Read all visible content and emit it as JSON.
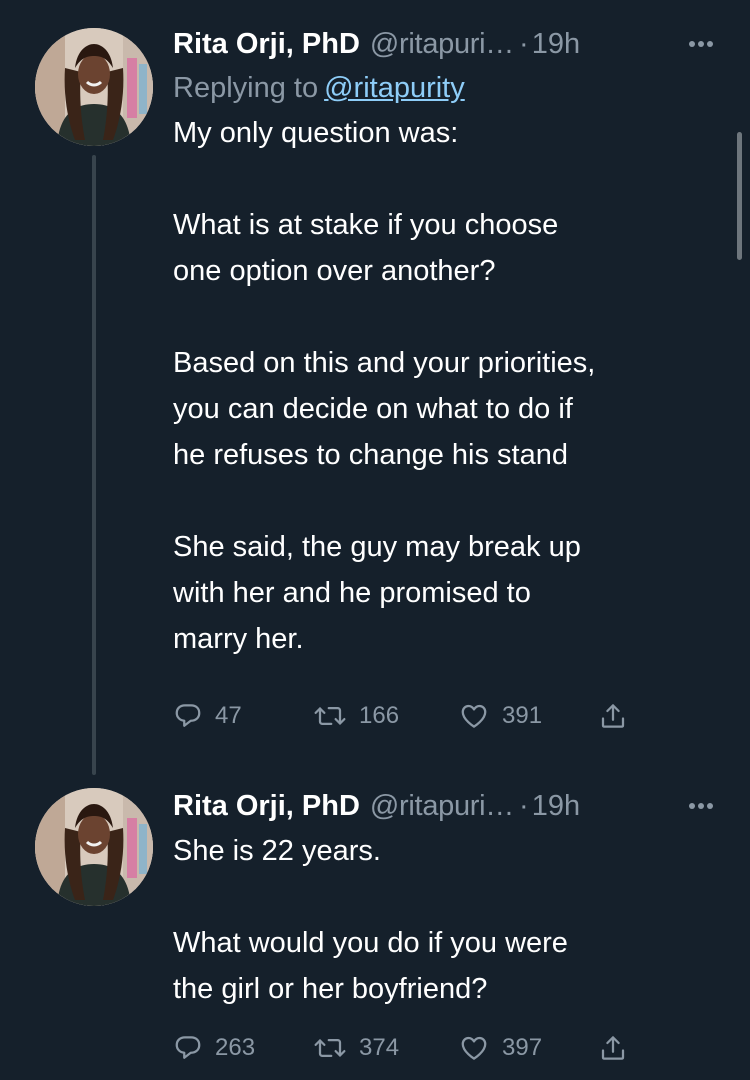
{
  "tweets": [
    {
      "author_name": "Rita Orji, PhD",
      "handle": "@ritapuri…",
      "separator": "·",
      "time": "19h",
      "replying_prefix": "Replying to",
      "replying_to": "@ritapurity",
      "paragraphs": [
        "My only question was:",
        "What is at stake if you choose\none option over another?",
        "Based on this and your priorities,\nyou can decide on what to do if\nhe refuses to change his stand",
        "She said, the guy may break up\nwith her and he promised to\nmarry her."
      ],
      "replies": "47",
      "retweets": "166",
      "likes": "391"
    },
    {
      "author_name": "Rita Orji, PhD",
      "handle": "@ritapuri…",
      "separator": "·",
      "time": "19h",
      "paragraphs": [
        "She is 22 years.",
        "What would you do if you were\nthe girl or her boyfriend?"
      ],
      "replies": "263",
      "retweets": "374",
      "likes": "397"
    }
  ],
  "icons": {
    "more": "more-horizontal-icon",
    "reply": "reply-bubble-icon",
    "retweet": "retweet-icon",
    "like": "heart-icon",
    "share": "share-upload-icon"
  },
  "colors": {
    "background": "#15202b",
    "text": "#ffffff",
    "secondary": "#8b98a5",
    "link": "#8ecdf8",
    "thread_line": "#38444d"
  }
}
